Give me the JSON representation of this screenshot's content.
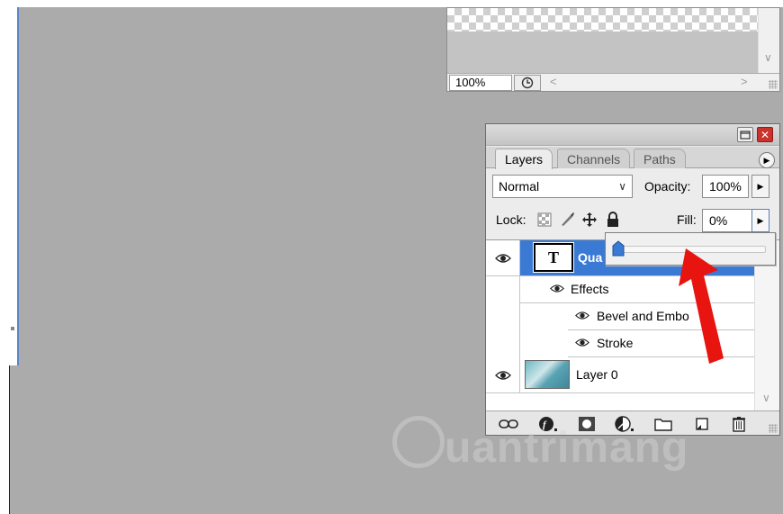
{
  "navigator": {
    "zoom_value": "100%"
  },
  "layers_panel": {
    "tabs": [
      {
        "label": "Layers",
        "active": true
      },
      {
        "label": "Channels",
        "active": false
      },
      {
        "label": "Paths",
        "active": false
      }
    ],
    "blend_mode": "Normal",
    "opacity_label": "Opacity:",
    "opacity_value": "100%",
    "lock_label": "Lock:",
    "fill_label": "Fill:",
    "fill_value": "0%",
    "layers": [
      {
        "name": "Qua",
        "type": "text",
        "thumb_glyph": "T",
        "selected": true
      },
      {
        "name": "Effects",
        "type": "effects-group"
      },
      {
        "name": "Bevel and Embo",
        "type": "effect"
      },
      {
        "name": "Stroke",
        "type": "effect"
      },
      {
        "name": "Layer 0",
        "type": "image"
      }
    ],
    "footer_icons": [
      "link-icon",
      "layer-style-icon",
      "mask-icon",
      "adjustment-layer-icon",
      "new-group-icon",
      "new-layer-icon",
      "trash-icon"
    ]
  },
  "fill_slider": {
    "level_percent": 0
  },
  "colors": {
    "selection": "#3a7ad5",
    "annotation_arrow": "#e8140f",
    "workspace": "#ababab"
  },
  "watermark": {
    "text": "uantrimang"
  }
}
